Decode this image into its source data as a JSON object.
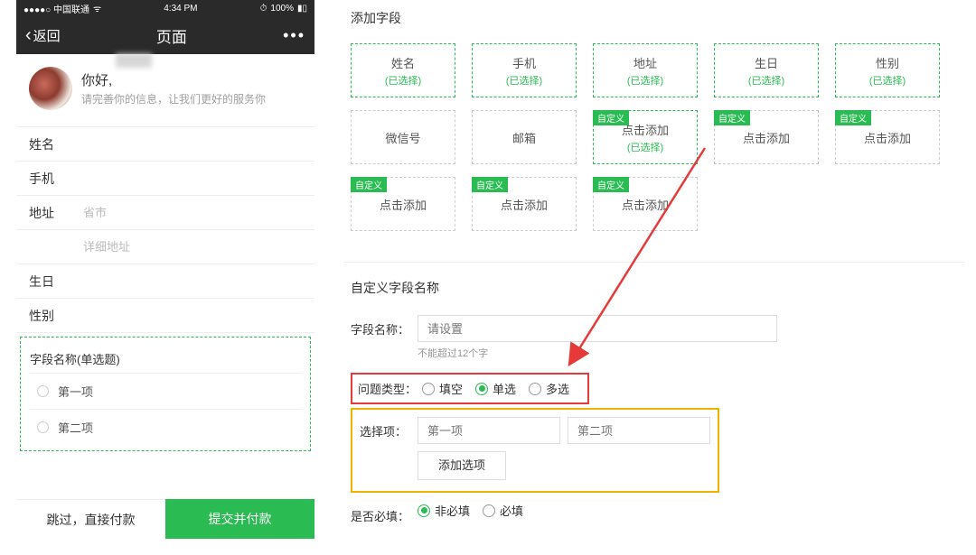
{
  "statusbar": {
    "carrier": "●●●●○ 中国联通",
    "wifi": "⍝",
    "time": "4:34 PM",
    "battery": "100%",
    "batt_icon": "▮"
  },
  "navbar": {
    "back": "返回",
    "title": "页面",
    "more": "•••"
  },
  "hello": {
    "greeting": "你好,",
    "sub": "请完善你的信息，让我们更好的服务你"
  },
  "form": {
    "rows": [
      {
        "label": "姓名",
        "value": ""
      },
      {
        "label": "手机",
        "value": ""
      },
      {
        "label": "地址",
        "value": "省市"
      },
      {
        "label": "",
        "value": "详细地址"
      },
      {
        "label": "生日",
        "value": ""
      },
      {
        "label": "性别",
        "value": ""
      }
    ]
  },
  "custom_preview": {
    "title": "字段名称(单选题)",
    "options": [
      "第一项",
      "第二项"
    ]
  },
  "footer": {
    "skip": "跳过，直接付款",
    "submit": "提交并付款"
  },
  "panel": {
    "title": "添加字段",
    "cards": [
      {
        "label": "姓名",
        "sub": "(已选择)",
        "selected": true
      },
      {
        "label": "手机",
        "sub": "(已选择)",
        "selected": true
      },
      {
        "label": "地址",
        "sub": "(已选择)",
        "selected": true
      },
      {
        "label": "生日",
        "sub": "(已选择)",
        "selected": true
      },
      {
        "label": "性别",
        "sub": "(已选择)",
        "selected": true
      },
      {
        "label": "微信号",
        "sub": "",
        "selected": false
      },
      {
        "label": "邮箱",
        "sub": "",
        "selected": false
      },
      {
        "label": "点击添加",
        "sub": "(已选择)",
        "selected": true,
        "badge": "自定义"
      },
      {
        "label": "点击添加",
        "sub": "",
        "selected": false,
        "badge": "自定义"
      },
      {
        "label": "点击添加",
        "sub": "",
        "selected": false,
        "badge": "自定义"
      },
      {
        "label": "点击添加",
        "sub": "",
        "selected": false,
        "badge": "自定义"
      },
      {
        "label": "点击添加",
        "sub": "",
        "selected": false,
        "badge": "自定义"
      },
      {
        "label": "点击添加",
        "sub": "",
        "selected": false,
        "badge": "自定义"
      }
    ]
  },
  "config": {
    "title": "自定义字段名称",
    "name_label": "字段名称：",
    "name_placeholder": "请设置",
    "name_hint": "不能超过12个字",
    "type_label": "问题类型：",
    "types": [
      "填空",
      "单选",
      "多选"
    ],
    "type_selected": 1,
    "options_label": "选择项：",
    "option_placeholders": [
      "第一项",
      "第二项"
    ],
    "add_option": "添加选项",
    "required_label": "是否必填：",
    "required_opts": [
      "非必填",
      "必填"
    ],
    "required_selected": 0
  }
}
